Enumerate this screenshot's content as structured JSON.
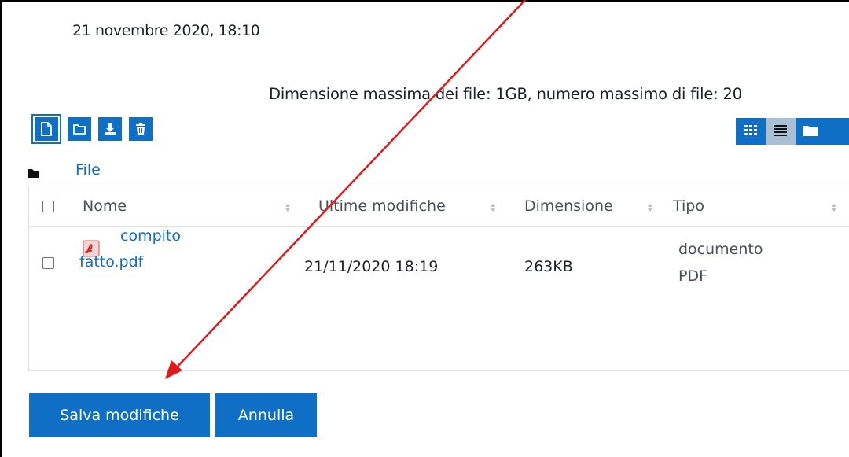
{
  "due_date": "21 novembre 2020, 18:10",
  "file_limits": "Dimensione massima dei file: 1GB, numero massimo di file: 20",
  "toolbar": {
    "icons": [
      "add-file-icon",
      "create-folder-icon",
      "download-icon",
      "delete-icon"
    ],
    "view_icons": [
      "grid-view-icon",
      "list-view-icon",
      "folder-tree-view-icon"
    ],
    "accent": "#0f6fc5"
  },
  "breadcrumb": {
    "label": "File"
  },
  "table": {
    "columns": [
      "Nome",
      "Ultime modifiche",
      "Dimensione",
      "Tipo"
    ],
    "rows": [
      {
        "name_line1": "compito",
        "name_line2": "fatto.pdf",
        "modified": "21/11/2020 18:19",
        "size": "263KB",
        "type_line1": "documento",
        "type_line2": "PDF"
      }
    ]
  },
  "actions": {
    "save_label": "Salva modifiche",
    "cancel_label": "Annulla"
  },
  "annotation": {
    "color": "#e0191a"
  }
}
